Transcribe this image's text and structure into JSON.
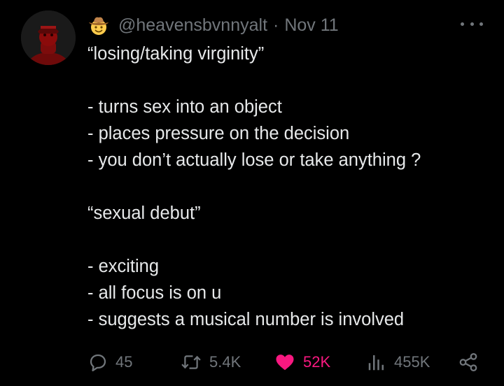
{
  "author": {
    "handle": "@heavensbvnnyalt",
    "separator": "·",
    "date": "Nov 11",
    "badge_emoji": "cowboy-face-emoji"
  },
  "tweet": {
    "lines": [
      "“losing/taking virginity”",
      "",
      "- turns sex into an object",
      "- places pressure on the decision",
      "- you don’t actually lose or take anything ?",
      "",
      "“sexual debut”",
      "",
      "- exciting",
      "- all focus is on u",
      "- suggests a musical number is involved"
    ]
  },
  "actions": {
    "replies": "45",
    "retweets": "5.4K",
    "likes": "52K",
    "views": "455K"
  },
  "colors": {
    "background": "#000000",
    "text": "#e7e9ea",
    "muted": "#71767b",
    "like": "#f91880",
    "avatar_red": "#8b0b0b"
  }
}
